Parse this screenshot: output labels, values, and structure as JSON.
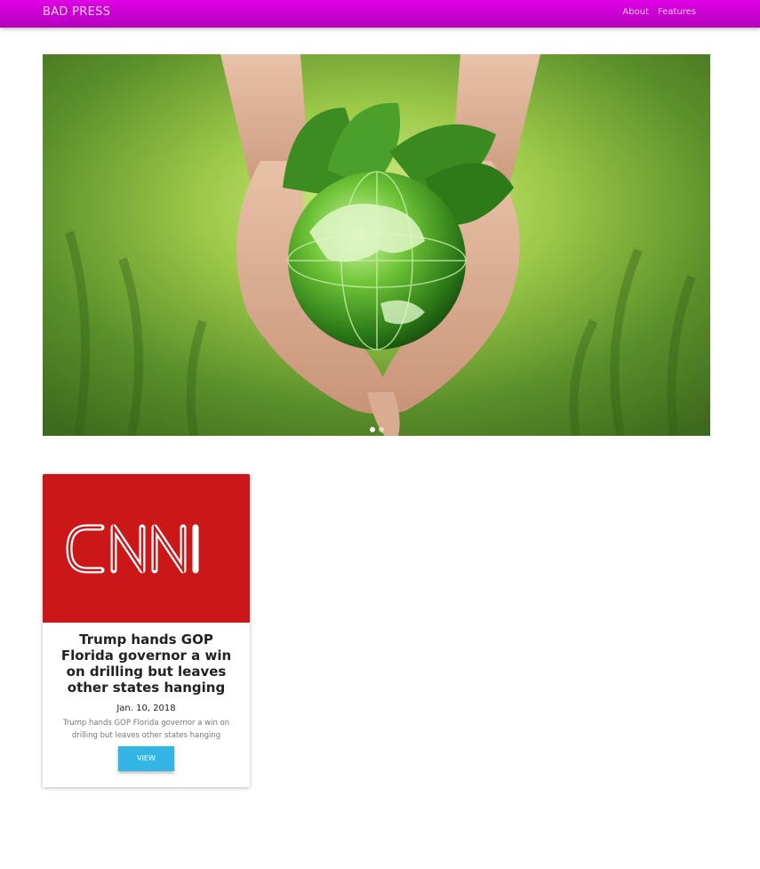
{
  "navbar": {
    "brand": "BAD PRESS",
    "links": [
      {
        "label": "About"
      },
      {
        "label": "Features"
      }
    ]
  },
  "carousel": {
    "image": "hands-holding-green-globe-with-leaves",
    "slide_count": 2,
    "active_slide": 1
  },
  "articles": [
    {
      "source_logo": "CNN",
      "logo_color": "#cc1719",
      "title": "Trump hands GOP Florida governor a win on drilling but leaves other states hanging",
      "date": "Jan. 10, 2018",
      "description": "Trump hands GOP Florida governor a win on drilling but leaves other states hanging",
      "button_label": "VIEW"
    }
  ],
  "colors": {
    "navbar": "#d600dc",
    "button": "#33b5e5"
  }
}
